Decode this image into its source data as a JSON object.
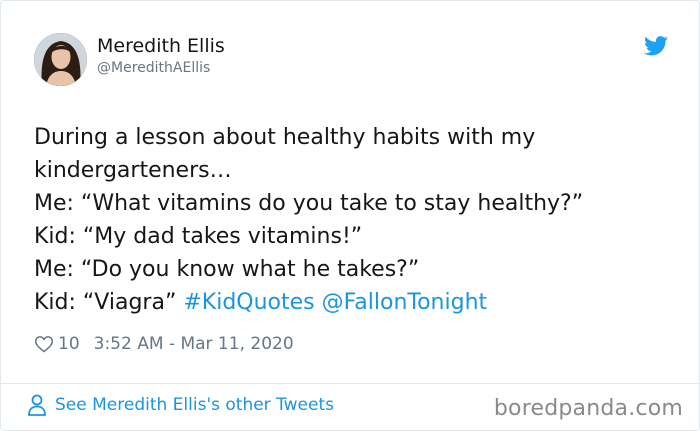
{
  "tweet": {
    "author": {
      "name": "Meredith Ellis",
      "handle": "@MeredithAEllis"
    },
    "text_lines": [
      "During a lesson about healthy habits with my",
      "kindergarteners…",
      "Me: “What vitamins do you take to stay healthy?”",
      "Kid: “My dad takes vitamins!”",
      "Me: “Do you know what he takes?”"
    ],
    "last_line": {
      "text": "Kid: “Viagra” ",
      "hashtag": "#KidQuotes",
      "mention": "@FallonTonight"
    },
    "likes": "10",
    "timestamp": "3:52 AM - Mar 11, 2020"
  },
  "footer": {
    "see_more": "See Meredith Ellis's other Tweets",
    "watermark": "boredpanda.com"
  },
  "colors": {
    "link": "#1b95e0",
    "muted": "#657786",
    "text": "#14171a",
    "border": "#e1e8ed"
  },
  "icons": [
    "twitter-bird-icon",
    "heart-icon",
    "person-icon"
  ]
}
